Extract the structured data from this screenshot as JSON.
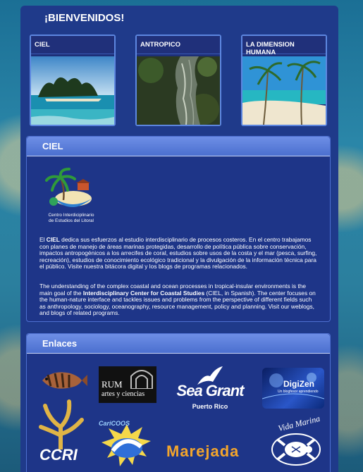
{
  "welcome": {
    "title": "¡BIENVENIDOS!"
  },
  "cards": [
    {
      "label": "CIEL"
    },
    {
      "label": "ANTROPICO"
    },
    {
      "label": "LA DIMENSION HUMANA"
    }
  ],
  "ciel": {
    "heading": "CIEL",
    "logo_text_1": "Centro Interdiciplinario",
    "logo_text_2": "de Estudios del Litoral",
    "es_pre": "El ",
    "es_bold": "CIEL",
    "es_post": " dedica sus esfuerzos al estudio interdisciplinario de procesos costeros. En el centro trabajamos con planes de manejo de áreas marinas protegidas, desarrollo de política pública sobre conservación, impactos antropogénicos a los arrecifes de coral, estudios sobre usos de la costa y el mar (pesca, surfing, recreación), estudios de conocimiento ecológico tradicional y la divulgación de la información técnica para el público. Visite nuestra bitácora digital y los blogs de programas relacionados.",
    "en_pre": "The understanding of the complex coastal and ocean processes in tropical-insular environments is the main goal of the ",
    "en_bold": "Interdisciplinary Center for Coastal Studies",
    "en_post": " (CIEL, in Spanish). The center focuses on the human-nature interface and tackles issues and problems from the perspective of different fields such as anthropology, sociology, oceanography, resource management, policy and planning. Visit our weblogs, and blogs of related programs."
  },
  "enlaces": {
    "heading": "Enlaces",
    "rum_1": "RUM",
    "rum_2": "artes y ciencias",
    "seagrant_1": "Sea Grant",
    "seagrant_2": "Puerto Rico",
    "digizen_1": "DigiZen",
    "digizen_2": "Un blogfesor aprendiendo",
    "ccri": "CCRI",
    "caricoos": "CariCOOS",
    "marejada": "Marejada",
    "vidamarina": "Vida Marina"
  }
}
